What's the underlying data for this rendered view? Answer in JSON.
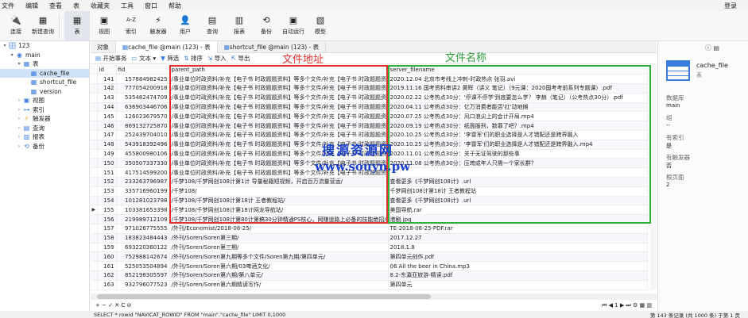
{
  "menubar": {
    "items": [
      "文件",
      "编辑",
      "查看",
      "表",
      "收藏夹",
      "工具",
      "窗口",
      "帮助"
    ],
    "login": "登录"
  },
  "toolbar": {
    "buttons": [
      {
        "label": "连接",
        "icon": "plug-icon"
      },
      {
        "label": "新建查询",
        "icon": "new-query-icon"
      },
      {
        "label": "表",
        "icon": "table-icon",
        "active": true
      },
      {
        "label": "视图",
        "icon": "view-icon"
      },
      {
        "label": "索引",
        "icon": "index-icon"
      },
      {
        "label": "触发器",
        "icon": "trigger-icon"
      },
      {
        "label": "用户",
        "icon": "user-icon"
      },
      {
        "label": "查询",
        "icon": "query-icon"
      },
      {
        "label": "报表",
        "icon": "report-icon"
      },
      {
        "label": "备份",
        "icon": "backup-icon"
      },
      {
        "label": "自动运行",
        "icon": "schedule-icon"
      },
      {
        "label": "模型",
        "icon": "model-icon"
      }
    ]
  },
  "tree": {
    "items": [
      {
        "label": "123",
        "level": 0,
        "twisty": "▾",
        "icon": "database-icon"
      },
      {
        "label": "main",
        "level": 1,
        "twisty": "▾",
        "icon": "schema-icon"
      },
      {
        "label": "表",
        "level": 2,
        "twisty": "▾",
        "icon": "tables-icon"
      },
      {
        "label": "cache_file",
        "level": 3,
        "twisty": "",
        "icon": "table-icon",
        "selected": true
      },
      {
        "label": "shortcut_file",
        "level": 3,
        "twisty": "",
        "icon": "table-icon"
      },
      {
        "label": "version",
        "level": 3,
        "twisty": "",
        "icon": "table-icon"
      },
      {
        "label": "视图",
        "level": 2,
        "twisty": "›",
        "icon": "view-icon"
      },
      {
        "label": "索引",
        "level": 2,
        "twisty": "›",
        "icon": "index-icon"
      },
      {
        "label": "触发器",
        "level": 2,
        "twisty": "›",
        "icon": "trigger-icon"
      },
      {
        "label": "查询",
        "level": 2,
        "twisty": "›",
        "icon": "query-icon"
      },
      {
        "label": "报表",
        "level": 2,
        "twisty": "›",
        "icon": "report-icon"
      },
      {
        "label": "备份",
        "level": 2,
        "twisty": "›",
        "icon": "backup-icon"
      }
    ]
  },
  "tabs": [
    {
      "label": "对象",
      "active": false
    },
    {
      "label": "cache_file @main (123) - 表",
      "active": true
    },
    {
      "label": "shortcut_file @main (123) - 表",
      "active": false
    }
  ],
  "table_toolbar": {
    "begin": "开始事务",
    "text": "文本",
    "filter": "筛选",
    "sort": "排序",
    "import": "导入",
    "export": "导出"
  },
  "annotations": {
    "path_label": "文件地址",
    "name_label": "文件名称"
  },
  "watermark": {
    "line1": "搜源资源网",
    "line2": "www.souyn.pw"
  },
  "grid": {
    "columns": [
      "id",
      "fid",
      "parent_path",
      "server_filename"
    ],
    "rows": [
      [
        "141",
        "157884982425",
        "/事业单位时政资料/补充【电子书 时政题题资料】等多个文件/补充【电子书 时政题题资料】",
        "2020.12.04 北京市考线上冲刺-时政热点 张羽.avi"
      ],
      [
        "142",
        "777054200918",
        "/事业单位时政资料/补充【电子书 时政题题资料】等多个文件/补充【电子书 时政题题资料】",
        "2019.11.16 国考资料串讲2 黄晖（讲义 笔记）（9元课：2020国考考前系列专题课）.pdf"
      ],
      [
        "143",
        "535482474709",
        "/事业单位时政资料/补充【电子书 时政题题资料】等多个文件/补充【电子书 时政题题资料】",
        "2020.02.22 公考热点30分：'停课不停学'到底要怎么学？ 李赫（笔记）（公考热点30分）.pdf"
      ],
      [
        "144",
        "636903446706",
        "/事业单位时政资料/补充【电子书 时政题题资料】等多个文件/补充【电子书 时政题题资料】",
        "2020.04.11 公考热点30分：亿万消费者能否'扛'动地摊"
      ],
      [
        "145",
        "126023679570",
        "/事业单位时政资料/补充【电子书 时政题题资料】等多个文件/补充【电子书 时政题题资料】",
        "2020.07.25 公考热点30分：风口浪尖上的会计开局.mp4"
      ],
      [
        "146",
        "869132725870",
        "/事业单位时政资料/补充【电子书 时政题题资料】等多个文件/补充【电子书 时政题题资料】",
        "2020.09.19 公考热点30分：纸面服刑，数罪了吧？.mp4"
      ],
      [
        "147",
        "252439704010",
        "/事业单位时政资料/补充【电子书 时政题题资料】等多个文件/补充【电子书 时政题题资料】",
        "2020.10.25 公考热点30分：'李雷军'们的职业选择是人才错配还是跨界融入"
      ],
      [
        "148",
        "543918392496",
        "/事业单位时政资料/补充【电子书 时政题题资料】等多个文件/补充【电子书 时政题题资料】",
        "2020.10.25 公考热点30分：'李雷军'们的职业选择是人才错配还是跨界融入.mp4"
      ],
      [
        "149",
        "455800980106",
        "/事业单位时政资料/补充【电子书 时政题题资料】等多个文件/补充【电子书 时政题题资料】",
        "2020.11.01 公考热点30分：关于无证驾驶的那些事"
      ],
      [
        "150",
        "350507337330",
        "/事业单位时政资料/补充【电子书 时政题题资料】等多个文件/补充【电子书 时政题题资料】",
        "2020.11.08 公考热点30分：压垮成年人只需一个家长群？"
      ],
      [
        "151",
        "417514599200",
        "/事业单位时政资料/补充【电子书 时政题题资料】等多个文件/补充【电子书 时政题题资料】",
        ""
      ],
      [
        "152",
        "233263796987",
        "/千梦108/千梦网创108计第1计 导量秘籍短视频，开启百万流量营运/",
        "查看更多《千梦网创108计》.url"
      ],
      [
        "153",
        "335716960199",
        "/千梦108/",
        "千梦网创108计第18计 王者教程站"
      ],
      [
        "154",
        "101281023798",
        "/千梦108/千梦网创108计第18计 王者教程站/",
        "查看更多《千梦网创108计》.url"
      ],
      [
        "155",
        "103381653398",
        "/千梦108/千梦网创108计第18计网龙导航站/",
        "美国导航.rar"
      ],
      [
        "156",
        "219989712109",
        "/千梦108/千梦网创108计第80计第稿30分钟精通PS核心，网赚道路上必备的技能绝招/",
        "港剧.jpg"
      ],
      [
        "157",
        "971026775555",
        "/外刊/Economist/2018-08-25/",
        "TE-2018-08-25-PDF.rar"
      ],
      [
        "158",
        "183823484443",
        "/外刊/Soren/Soren第三期/",
        "2017.12.27"
      ],
      [
        "159",
        "693220360122",
        "/外刊/Soren/Soren第三期/",
        "2018.1.8"
      ],
      [
        "160",
        "752988142674",
        "/外刊/Soren/Soren第九期等多个文件/Soren第九期/第四单元/",
        "第四单元创作.pdf"
      ],
      [
        "161",
        "525053504894",
        "/外刊/Soren/Soren第六期/03啤酒文化/",
        "06 All the beer in China.mp3"
      ],
      [
        "162",
        "852198305597",
        "/外刊/Soren/Soren第六期/第八单元/",
        "8.2-东瀛亚旅游-精读.pdf"
      ],
      [
        "163",
        "932796077523",
        "/外刊/Soren/Soren第六期精读写作/",
        "第四单元"
      ]
    ]
  },
  "bottombar": {
    "left": "+ − ✓ ✕ C ⊘",
    "right": "⏮ ◀ 1 ▶ ⏭ ⚙ ▦ ▥"
  },
  "statusbar": {
    "sql": "SELECT * rowid \"NAVICAT_ROWID\" FROM \"main\".\"cache_file\" LIMIT 0,1000",
    "summary": "第 143 条记录 (共 1000 条) 于第 1 页"
  },
  "info": {
    "table_name": "cache_file",
    "subtitle": "表",
    "fields": [
      {
        "key": "数据库",
        "value": "main"
      },
      {
        "key": "组",
        "value": "--"
      },
      {
        "key": "有索引",
        "value": "是"
      },
      {
        "key": "有触发器",
        "value": "否"
      },
      {
        "key": "根页面",
        "value": "2"
      }
    ]
  }
}
